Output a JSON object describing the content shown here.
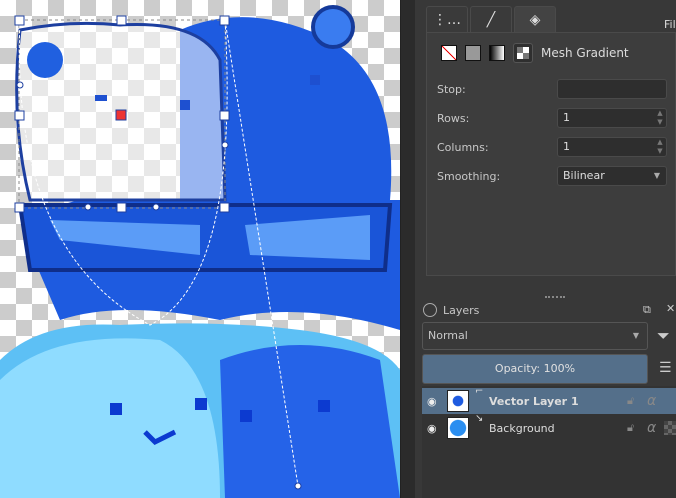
{
  "tool_options": {
    "tabs": [
      {
        "icon": "shape-icon"
      },
      {
        "icon": "stroke-icon"
      },
      {
        "icon": "fill-bucket-icon"
      }
    ],
    "tab_partial": "Fil",
    "fill_type": "Mesh Gradient",
    "fields": [
      {
        "label": "Stop:",
        "value": ""
      },
      {
        "label": "Rows:",
        "value": "1"
      },
      {
        "label": "Columns:",
        "value": "1"
      },
      {
        "label": "Smoothing:",
        "value": "Bilinear"
      }
    ]
  },
  "layers": {
    "title": "Layers",
    "blend_mode": "Normal",
    "opacity_label": "Opacity:  100%",
    "opacity": 100,
    "items": [
      {
        "name": "Vector Layer 1",
        "selected": true
      },
      {
        "name": "Background",
        "selected": false
      }
    ]
  },
  "colors": {
    "selection": "#546f8a",
    "art_blue": "#1e5be0"
  }
}
